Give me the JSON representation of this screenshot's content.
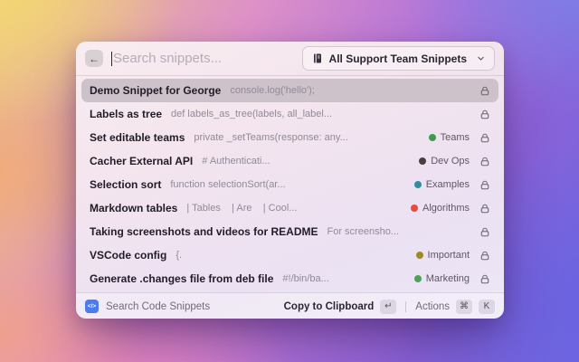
{
  "window": {
    "header": {
      "back_icon": "←",
      "search": {
        "placeholder": "Search snippets..."
      },
      "dropdown": {
        "label": "All Support Team Snippets"
      }
    },
    "rows": [
      {
        "title": "Demo Snippet for George",
        "code": "console.log('hello');",
        "tag": null,
        "selected": true
      },
      {
        "title": "Labels as tree",
        "code": "def labels_as_tree(labels, all_label...",
        "tag": null,
        "selected": false
      },
      {
        "title": "Set editable teams",
        "code": "private _setTeams(response: any...",
        "tag": {
          "label": "Teams",
          "color": "#3d9a50"
        },
        "selected": false
      },
      {
        "title": "Cacher External API",
        "code": "# Authenticati...",
        "tag": {
          "label": "Dev Ops",
          "color": "#46413b"
        },
        "selected": false
      },
      {
        "title": "Selection sort",
        "code": "function selectionSort(ar...",
        "tag": {
          "label": "Examples",
          "color": "#2f8ea0"
        },
        "selected": false
      },
      {
        "title": "Markdown tables",
        "code": "| Tables    | Are    | Cool...",
        "tag": {
          "label": "Algorithms",
          "color": "#e64b3c"
        },
        "selected": false
      },
      {
        "title": "Taking screenshots and videos for README",
        "code": "For screensho...",
        "tag": null,
        "selected": false
      },
      {
        "title": "VSCode config",
        "code": "{.",
        "tag": {
          "label": "Important",
          "color": "#9d8b20"
        },
        "selected": false
      },
      {
        "title": "Generate .changes file from deb file",
        "code": "#!/bin/ba...",
        "tag": {
          "label": "Marketing",
          "color": "#4aa357"
        },
        "selected": false
      }
    ],
    "footer": {
      "app_icon_glyph": "</>",
      "app_name": "Search Code Snippets",
      "primary_action": "Copy to Clipboard",
      "primary_key": "↵",
      "secondary_action": "Actions",
      "secondary_keys": [
        "⌘",
        "K"
      ]
    }
  },
  "colors": {
    "selected_row": "#cdc2ca",
    "app_icon_blue": "#4b7bee",
    "window_tint_top": "#f9edf0",
    "window_tint_bottom": "#ece7f6",
    "bg_yellow": "#f4da72",
    "bg_orange": "#f2aa76",
    "bg_salmon": "#f0a08c",
    "bg_pink": "#ec86c0",
    "bg_periwinkle": "#7a82ea",
    "bg_purple": "#6962e0"
  }
}
